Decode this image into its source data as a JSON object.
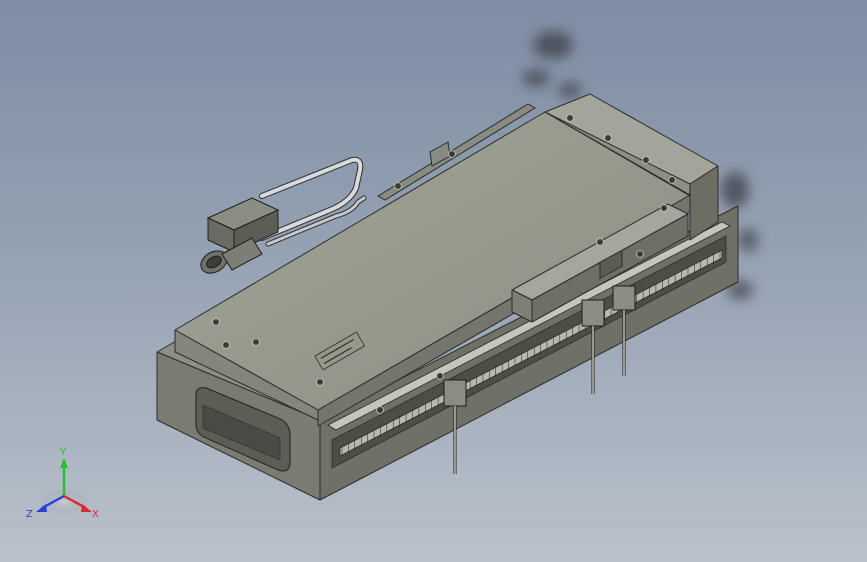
{
  "viewport": {
    "background_top": "#7e8da3",
    "background_bottom": "#b9c1ca"
  },
  "part_colors": {
    "body": "#7a7b70",
    "top": "#9fa095",
    "front": "#8c8d82",
    "side": "#6f7066",
    "edge": "#2c2d28",
    "cable": "#d8dadc"
  },
  "triad": {
    "y_label": "Y",
    "x_label": "X",
    "z_label": "Z",
    "y_color": "#22c02a",
    "x_color": "#e02828",
    "z_color": "#2a3fd8"
  }
}
